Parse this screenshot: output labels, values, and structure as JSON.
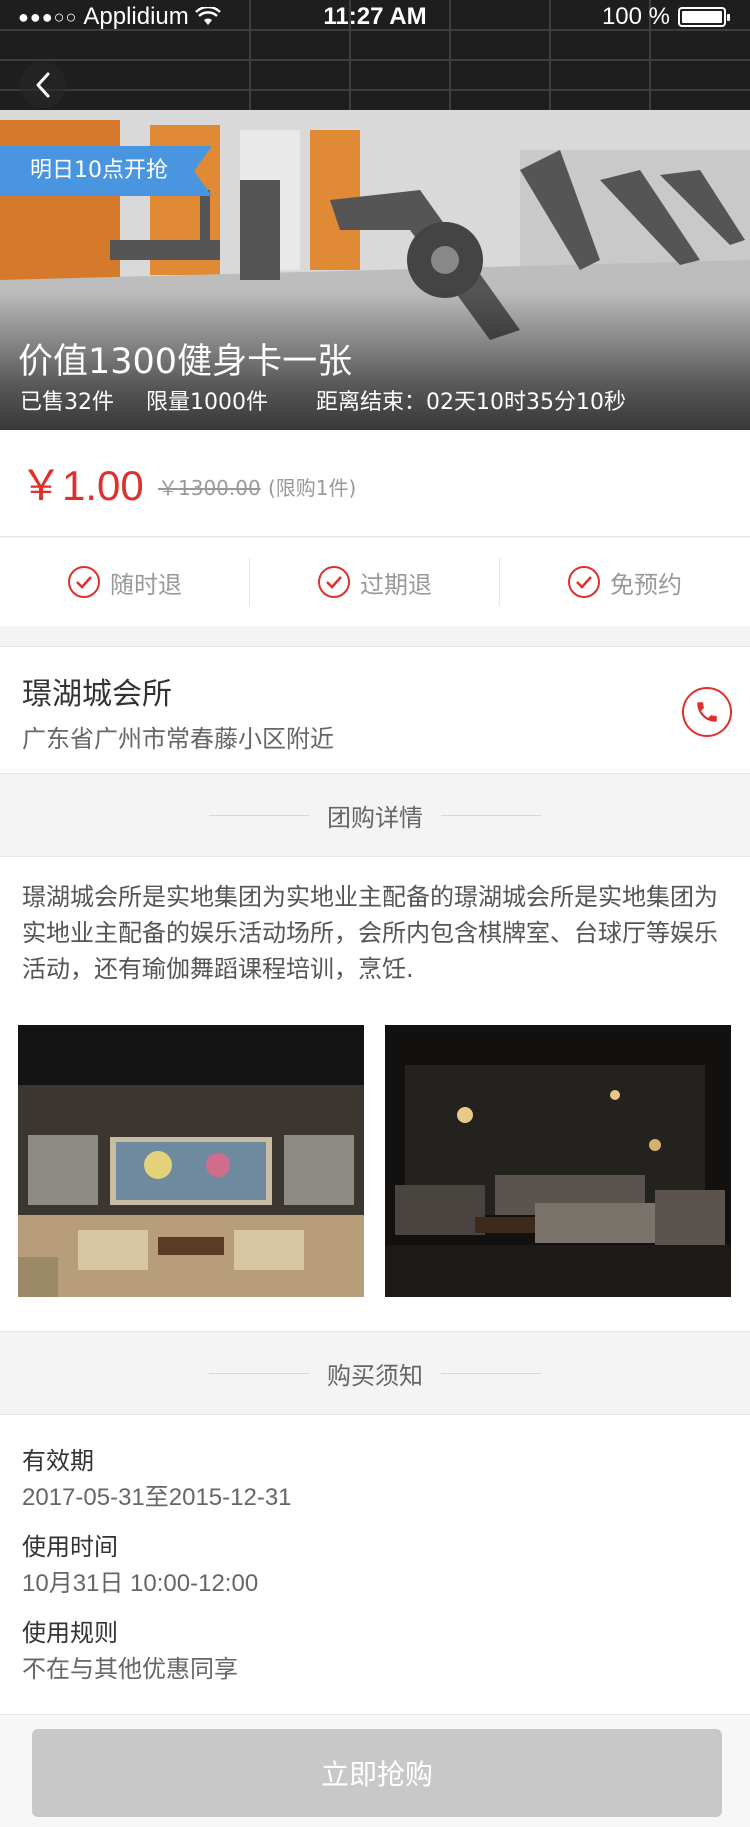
{
  "status_bar": {
    "carrier": "Applidium",
    "signal_dots": "●●●○○",
    "time": "11:27 AM",
    "battery": "100 %"
  },
  "hero": {
    "ribbon": "明日10点开抢",
    "title": "价值1300健身卡一张",
    "sold": "已售32件",
    "limit": "限量1000件",
    "countdown": "距离结束：02天10时35分10秒"
  },
  "price": {
    "current": "￥1.00",
    "original": "￥1300.00",
    "note": "(限购1件)"
  },
  "guarantees": [
    "随时退",
    "过期退",
    "免预约"
  ],
  "venue": {
    "name": "璟湖城会所",
    "address": "广东省广州市常春藤小区附近"
  },
  "detail": {
    "header": "团购详情",
    "text": "璟湖城会所是实地集团为实地业主配备的璟湖城会所是实地集团为实地业主配备的娱乐活动场所，会所内包含棋牌室、台球厅等娱乐活动，还有瑜伽舞蹈课程培训，烹饪."
  },
  "notes": {
    "header": "购买须知",
    "items": [
      {
        "label": "有效期",
        "value": "2017-05-31至2015-12-31"
      },
      {
        "label": "使用时间",
        "value": "10月31日  10:00-12:00"
      },
      {
        "label": "使用规则",
        "value": "不在与其他优惠同享"
      }
    ]
  },
  "footer": {
    "buy_label": "立即抢购"
  },
  "colors": {
    "accent": "#e0302c",
    "ribbon": "#4a95e0",
    "disabled_button": "#c8c8c8"
  }
}
